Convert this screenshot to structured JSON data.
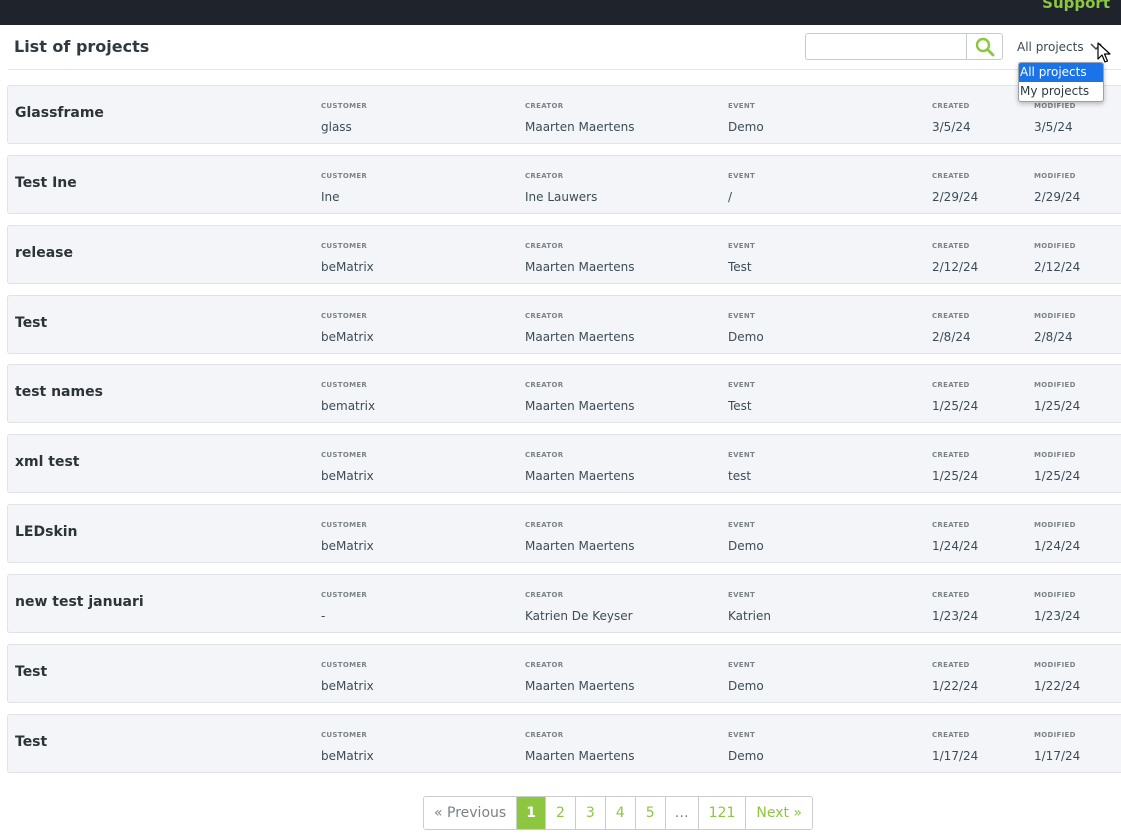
{
  "topbar": {
    "support_label": "Support"
  },
  "header": {
    "title": "List of projects",
    "search_value": "",
    "search_placeholder": "",
    "filter_selected": "All projects",
    "filter_options": [
      "All projects",
      "My projects"
    ]
  },
  "labels": {
    "customer": "CUSTOMER",
    "creator": "CREATOR",
    "event": "EVENT",
    "created": "CREATED",
    "modified": "MODIFIED"
  },
  "projects": [
    {
      "name": "Glassframe",
      "customer": "glass",
      "creator": "Maarten Maertens",
      "event": "Demo",
      "created": "3/5/24",
      "modified": "3/5/24"
    },
    {
      "name": "Test Ine",
      "customer": "Ine",
      "creator": "Ine Lauwers",
      "event": "/",
      "created": "2/29/24",
      "modified": "2/29/24"
    },
    {
      "name": "release",
      "customer": "beMatrix",
      "creator": "Maarten Maertens",
      "event": "Test",
      "created": "2/12/24",
      "modified": "2/12/24"
    },
    {
      "name": "Test",
      "customer": "beMatrix",
      "creator": "Maarten Maertens",
      "event": "Demo",
      "created": "2/8/24",
      "modified": "2/8/24"
    },
    {
      "name": "test names",
      "customer": "bematrix",
      "creator": "Maarten Maertens",
      "event": "Test",
      "created": "1/25/24",
      "modified": "1/25/24"
    },
    {
      "name": "xml test",
      "customer": "beMatrix",
      "creator": "Maarten Maertens",
      "event": "test",
      "created": "1/25/24",
      "modified": "1/25/24"
    },
    {
      "name": "LEDskin",
      "customer": "beMatrix",
      "creator": "Maarten Maertens",
      "event": "Demo",
      "created": "1/24/24",
      "modified": "1/24/24"
    },
    {
      "name": "new test januari",
      "customer": "-",
      "creator": "Katrien De Keyser",
      "event": "Katrien",
      "created": "1/23/24",
      "modified": "1/23/24"
    },
    {
      "name": "Test",
      "customer": "beMatrix",
      "creator": "Maarten Maertens",
      "event": "Demo",
      "created": "1/22/24",
      "modified": "1/22/24"
    },
    {
      "name": "Test",
      "customer": "beMatrix",
      "creator": "Maarten Maertens",
      "event": "Demo",
      "created": "1/17/24",
      "modified": "1/17/24"
    }
  ],
  "pagination": {
    "previous": "« Previous",
    "pages": [
      "1",
      "2",
      "3",
      "4",
      "5",
      "…",
      "121"
    ],
    "current": "1",
    "next": "Next »"
  },
  "colors": {
    "accent": "#8dc63f",
    "topbar": "#1f242c",
    "selected_option": "#1a73e8"
  },
  "icons": {
    "search": "search-icon",
    "filter_chevron": "chevron-down-icon",
    "cursor": "mouse-cursor-icon"
  }
}
